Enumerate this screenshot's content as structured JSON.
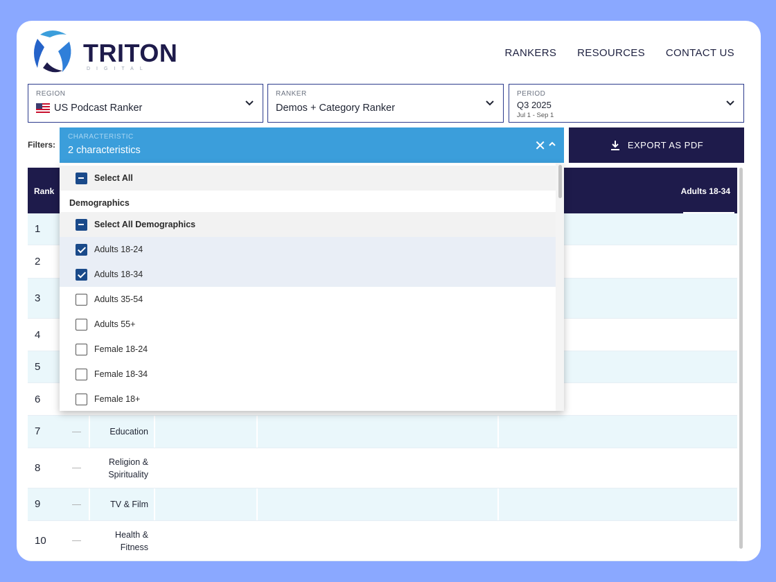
{
  "brand": {
    "name": "TRITON",
    "sub": "DIGITAL"
  },
  "nav": [
    {
      "label": "RANKERS"
    },
    {
      "label": "RESOURCES"
    },
    {
      "label": "CONTACT US"
    }
  ],
  "selectors": {
    "region": {
      "label": "REGION",
      "value": "US Podcast Ranker"
    },
    "ranker": {
      "label": "RANKER",
      "value": "Demos + Category Ranker"
    },
    "period": {
      "label": "PERIOD",
      "value": "Q3 2025",
      "sub": "Jul 1 - Sep 1"
    }
  },
  "filters": {
    "label": "Filters:",
    "characteristic": {
      "label": "CHARACTERISTIC",
      "value": "2 characteristics"
    },
    "export_label": "EXPORT AS PDF"
  },
  "table": {
    "headers": {
      "rank": "Rank",
      "adults": "Adults 18-34"
    },
    "rows": [
      {
        "rank": "1"
      },
      {
        "rank": "2"
      },
      {
        "rank": "3"
      },
      {
        "rank": "4"
      },
      {
        "rank": "5"
      },
      {
        "rank": "6"
      },
      {
        "rank": "7",
        "dash": "—",
        "category": "Education"
      },
      {
        "rank": "8",
        "dash": "—",
        "category": "Religion & Spirituality"
      },
      {
        "rank": "9",
        "dash": "—",
        "category": "TV & Film"
      },
      {
        "rank": "10",
        "dash": "—",
        "category": "Health & Fitness"
      }
    ]
  },
  "dropdown": {
    "select_all": "Select All",
    "group": "Demographics",
    "select_all_group": "Select All Demographics",
    "options": [
      {
        "label": "Adults 18-24",
        "checked": true
      },
      {
        "label": "Adults 18-34",
        "checked": true
      },
      {
        "label": "Adults 35-54",
        "checked": false
      },
      {
        "label": "Adults 55+",
        "checked": false
      },
      {
        "label": "Female 18-24",
        "checked": false
      },
      {
        "label": "Female 18-34",
        "checked": false
      },
      {
        "label": "Female 18+",
        "checked": false
      }
    ]
  },
  "colors": {
    "navy": "#1e1b4b",
    "accent": "#3b9edb",
    "check": "#1a4a8a",
    "row_alt": "#eaf7fb"
  }
}
